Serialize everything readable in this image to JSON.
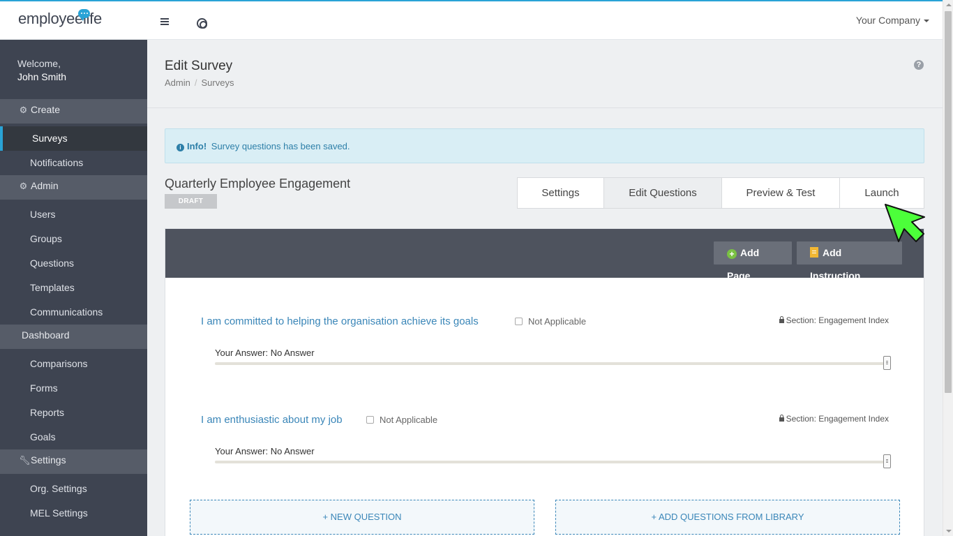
{
  "header": {
    "logo": {
      "prefix": "employee",
      "suffix": "life"
    },
    "company_menu": "Your Company"
  },
  "sidebar": {
    "welcome": "Welcome,",
    "user_name": "John Smith",
    "sections": [
      {
        "label": "Create",
        "icon": "gear-icon",
        "items": [
          "Surveys",
          "Notifications"
        ]
      },
      {
        "label": "Admin",
        "icon": "gear-icon",
        "items": [
          "Users",
          "Groups",
          "Questions",
          "Templates",
          "Communications"
        ]
      },
      {
        "label": "Dashboard",
        "icon": "",
        "items": [
          "Comparisons",
          "Forms",
          "Reports",
          "Goals"
        ]
      },
      {
        "label": "Settings",
        "icon": "wrench-icon",
        "items": [
          "Org. Settings",
          "MEL Settings"
        ]
      }
    ],
    "active_item": "Surveys"
  },
  "page": {
    "title": "Edit Survey",
    "breadcrumb": [
      "Admin",
      "Surveys"
    ]
  },
  "alert": {
    "strong": "Info!",
    "message": "Survey questions has been saved."
  },
  "survey": {
    "name": "Quarterly Employee Engagement",
    "status": "DRAFT"
  },
  "tabs": [
    {
      "label": "Settings",
      "active": false
    },
    {
      "label": "Edit Questions",
      "active": true
    },
    {
      "label": "Preview & Test",
      "active": false
    },
    {
      "label": "Launch",
      "active": false
    }
  ],
  "toolbar": {
    "add_page": "Add Page",
    "add_instruction": "Add Instruction"
  },
  "questions": [
    {
      "text": "I am committed to helping the organisation achieve its goals",
      "not_applicable": "Not Applicable",
      "section": "Section: Engagement Index",
      "answer": "Your Answer: No Answer",
      "slider_value": 1.0
    },
    {
      "text": "I am enthusiastic about my job",
      "not_applicable": "Not Applicable",
      "section": "Section: Engagement Index",
      "answer": "Your Answer: No Answer",
      "slider_value": 1.0
    }
  ],
  "actions": {
    "new_question": "+ NEW QUESTION",
    "add_from_library": "+ ADD QUESTIONS FROM LIBRARY"
  },
  "colors": {
    "accent": "#29a3d6",
    "sidebar": "#3e4451",
    "link": "#3a86b8",
    "cursor": "#4cff3a"
  }
}
